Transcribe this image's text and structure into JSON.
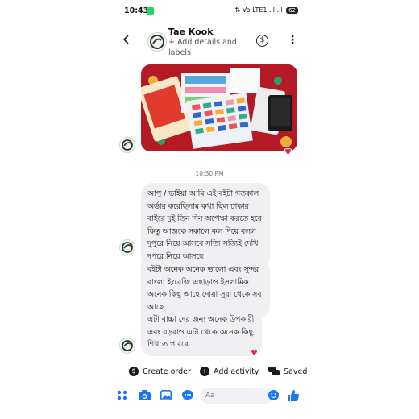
{
  "status_bar": {
    "time": "10:43",
    "icons_text": "⇅ Vo LTE1 .ıl .ıl",
    "battery": "62"
  },
  "header": {
    "back_icon": "chevron-left-icon",
    "contact_name": "Tae Kook",
    "subtitle": "+ Add details and labels",
    "dollar_icon": "dollar-circle-icon",
    "more_icon": "more-vertical-icon"
  },
  "messages": {
    "photo_reaction": "♥",
    "timestamp": "10:30 PM",
    "bubble_1": "আপু / ভাইয়া আমি এই বইটা গতকাল অর্ডার করেছিলাম কথা ছিল ঢাকার বাইরে দুই তিন দিন অপেক্ষা করতে হবে কিন্তু আজকে সকালে কল দিয়ে বলল দুপুরে নিয়ে আসবে সত্যি সত্যিই দেখি দুপুরে নিয়ে আসছে",
    "bubble_2": "বইটা অনেক অনেক ভালো এবং সুন্দর বাংলা ইংরেজি এছাড়াও ইসলামিক অনেক কিছু আছে দোয়া সুরা থেকে সব আছে",
    "bubble_3": "এটা বাচ্চা দের জন্য অনেক উপকারী এবং বড়রাও এটা থেকে অনেক কিছু শিখতে পারবে",
    "bubble_3_reaction": "♥"
  },
  "actions": {
    "create_order": "Create order",
    "add_activity": "Add activity",
    "saved": "Saved"
  },
  "composer": {
    "placeholder": "Aa",
    "icons": [
      "grid-icon",
      "camera-icon",
      "image-icon",
      "chat-bubble-icon",
      "emoji-icon",
      "thumbs-up-icon"
    ]
  },
  "colors": {
    "accent": "#1877f2",
    "bubble_bg": "#f0f0f3",
    "reaction": "#e0245e",
    "photo_bg": "#b31a26"
  }
}
